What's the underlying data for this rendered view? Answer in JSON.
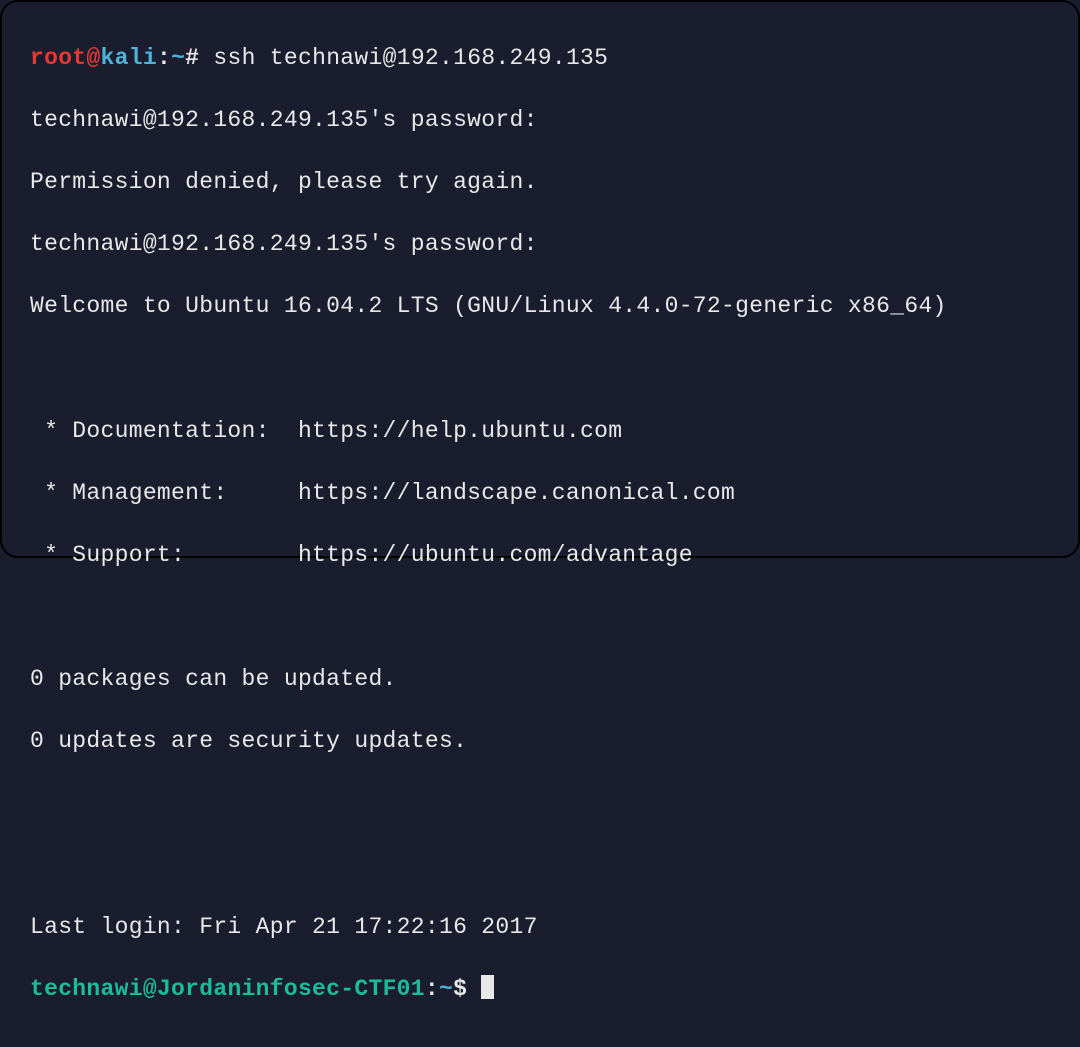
{
  "prompt1": {
    "user": "root",
    "sep1": "@",
    "host": "kali",
    "sep2": ":",
    "path": "~",
    "symbol": "#",
    "command": "ssh technawi@192.168.249.135"
  },
  "lines": {
    "pw1": "technawi@192.168.249.135's password:",
    "denied": "Permission denied, please try again.",
    "pw2": "technawi@192.168.249.135's password:",
    "welcome": "Welcome to Ubuntu 16.04.2 LTS (GNU/Linux 4.4.0-72-generic x86_64)",
    "doc": " * Documentation:  https://help.ubuntu.com",
    "mgmt": " * Management:     https://landscape.canonical.com",
    "support": " * Support:        https://ubuntu.com/advantage",
    "pkg": "0 packages can be updated.",
    "sec": "0 updates are security updates.",
    "lastlogin": "Last login: Fri Apr 21 17:22:16 2017"
  },
  "prompt2": {
    "user": "technawi",
    "sep1": "@",
    "host": "Jordaninfosec-CTF01",
    "sep2": ":",
    "path": "~",
    "symbol": "$"
  }
}
